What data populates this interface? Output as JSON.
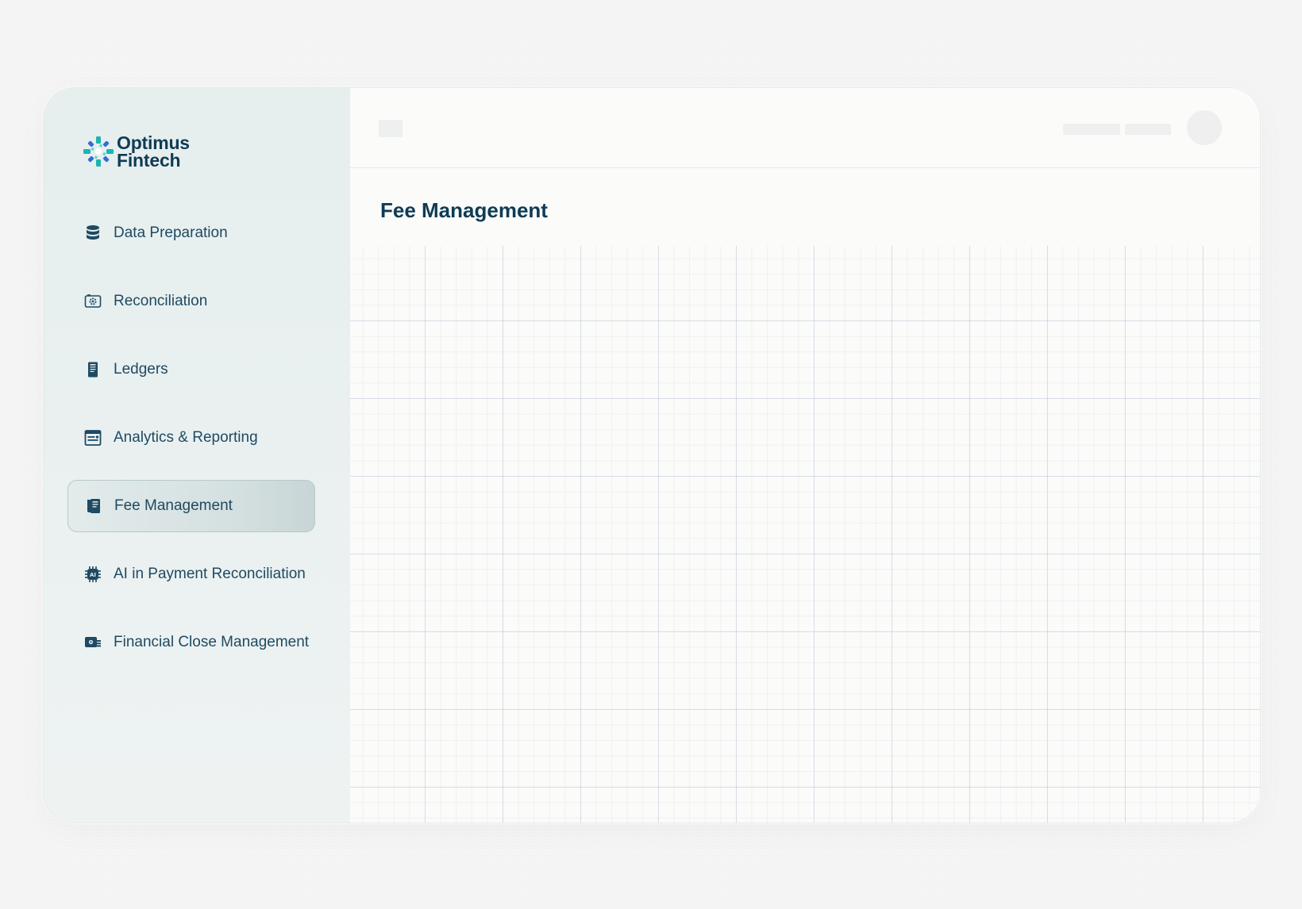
{
  "brand": {
    "line1": "Optimus",
    "line2": "Fintech",
    "colors": {
      "primary": "#0f3b55",
      "accent_teal": "#19b6b0",
      "accent_blue": "#2a6fd6"
    },
    "logo_icon": "optimus-fintech-logo-icon"
  },
  "sidebar": {
    "items": [
      {
        "label": "Data Preparation",
        "icon": "database-icon",
        "active": false
      },
      {
        "label": "Reconciliation",
        "icon": "camera-gear-icon",
        "active": false
      },
      {
        "label": "Ledgers",
        "icon": "ledger-book-icon",
        "active": false
      },
      {
        "label": "Analytics & Reporting",
        "icon": "report-window-icon",
        "active": false
      },
      {
        "label": "Fee Management",
        "icon": "fee-document-icon",
        "active": true
      },
      {
        "label": "AI in Payment Reconciliation",
        "icon": "ai-chip-icon",
        "active": false
      },
      {
        "label": "Financial Close Management",
        "icon": "close-wallet-icon",
        "active": false
      }
    ]
  },
  "main": {
    "page_title": "Fee Management"
  }
}
